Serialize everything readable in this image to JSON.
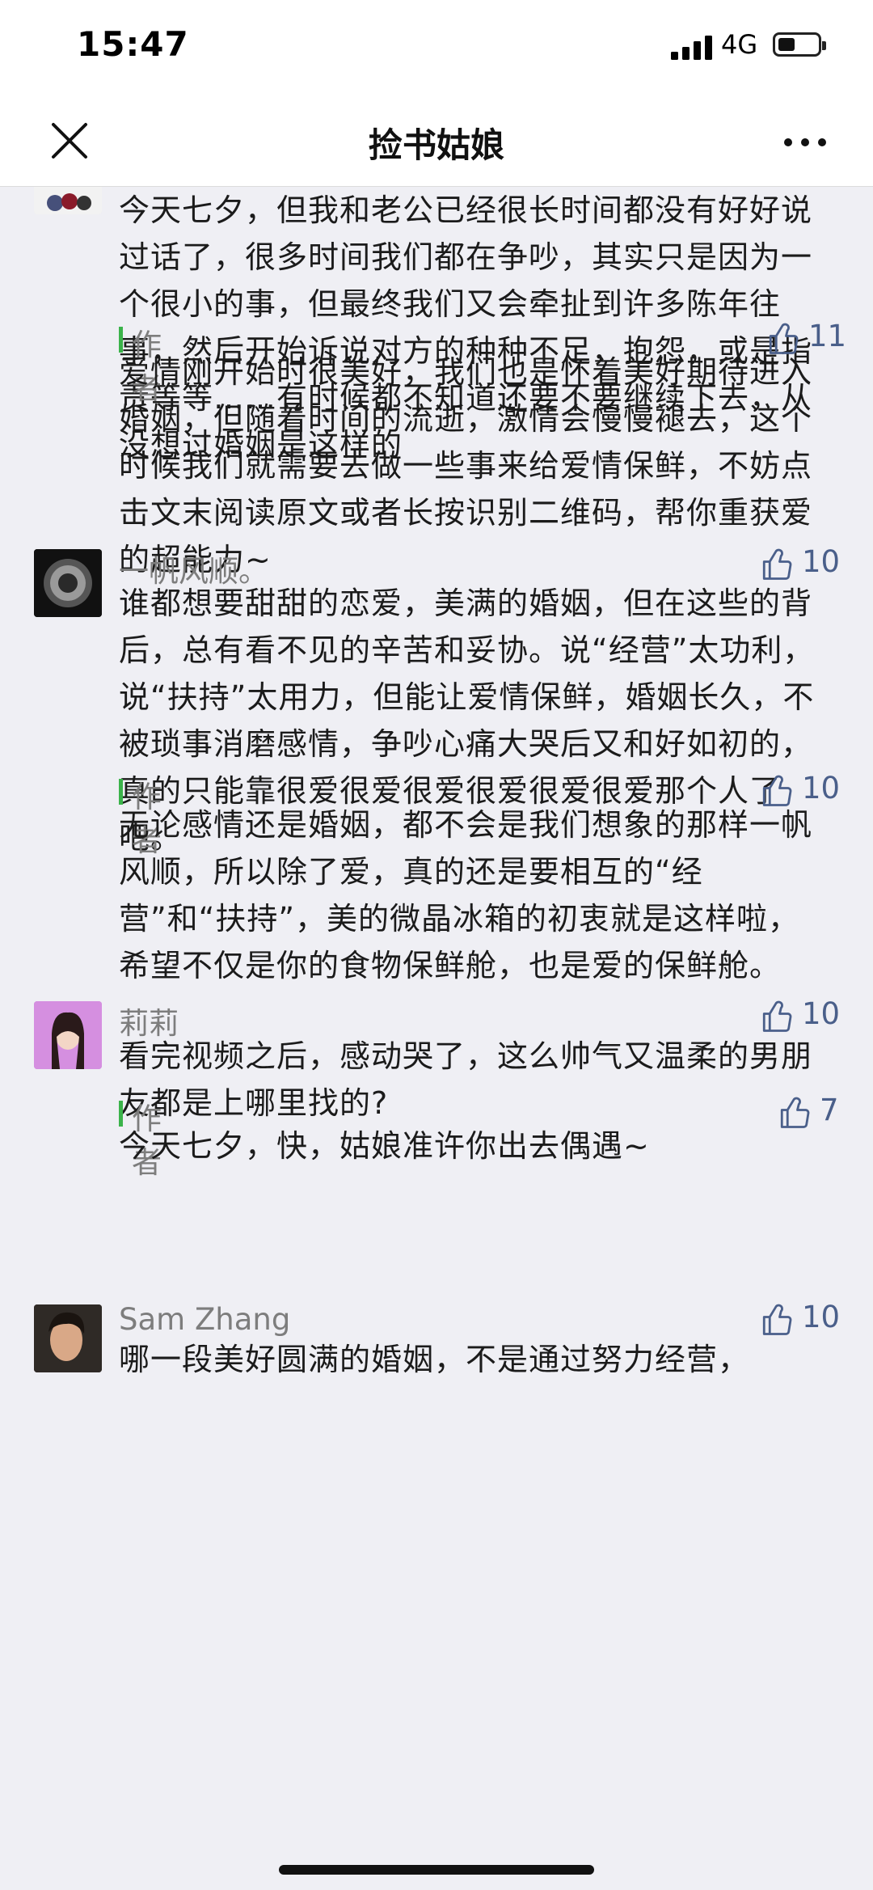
{
  "status_bar": {
    "time": "15:47",
    "network": "4G"
  },
  "nav": {
    "title": "捡书姑娘"
  },
  "comments": [
    {
      "text": "今天七夕，但我和老公已经很长时间都没有好好说过话了，很多时间我们都在争吵，其实只是因为一个很小的事，但最终我们又会牵扯到许多陈年往事，然后开始诉说对方的种种不足，抱怨，或是指责等等……有时候都不知道还要不要继续下去，从没想过婚姻是这样的",
      "reply": {
        "label": "作者",
        "likes": "11",
        "text": "爱情刚开始时很美好，我们也是怀着美好期待进入婚姻，但随着时间的流逝，激情会慢慢褪去，这个时候我们就需要去做一些事来给爱情保鲜，不妨点击文末阅读原文或者长按识别二维码，帮你重获爱的超能力~"
      }
    },
    {
      "name": "一帆风顺。",
      "likes": "10",
      "text": "谁都想要甜甜的恋爱，美满的婚姻，但在这些的背后，总有看不见的辛苦和妥协。说“经营”太功利，说“扶持”太用力，但能让爱情保鲜，婚姻长久，不被琐事消磨感情，争吵心痛大哭后又和好如初的，真的只能靠很爱很爱很爱很爱很爱很爱那个人了吧。",
      "reply": {
        "label": "作者",
        "likes": "10",
        "text": "无论感情还是婚姻，都不会是我们想象的那样一帆风顺，所以除了爱，真的还是要相互的“经营”和“扶持”，美的微晶冰箱的初衷就是这样啦，希望不仅是你的食物保鲜舱，也是爱的保鲜舱。"
      }
    },
    {
      "name": "莉莉",
      "likes": "10",
      "text": "看完视频之后，感动哭了，这么帅气又温柔的男朋友都是上哪里找的?",
      "reply": {
        "label": "作者",
        "likes": "7",
        "text": "今天七夕，快，姑娘准许你出去偶遇~"
      }
    },
    {
      "name": "Sam Zhang",
      "likes": "10",
      "text": "哪一段美好圆满的婚姻，不是通过努力经营，"
    }
  ],
  "colors": {
    "background": "#efeff4",
    "author_bar": "#3bb34a",
    "like_count": "#4a5f8a",
    "muted_text": "#7d7d7d"
  },
  "icons": [
    "close-icon",
    "more-icon",
    "thumbs-up-icon",
    "signal-icon",
    "battery-icon"
  ]
}
